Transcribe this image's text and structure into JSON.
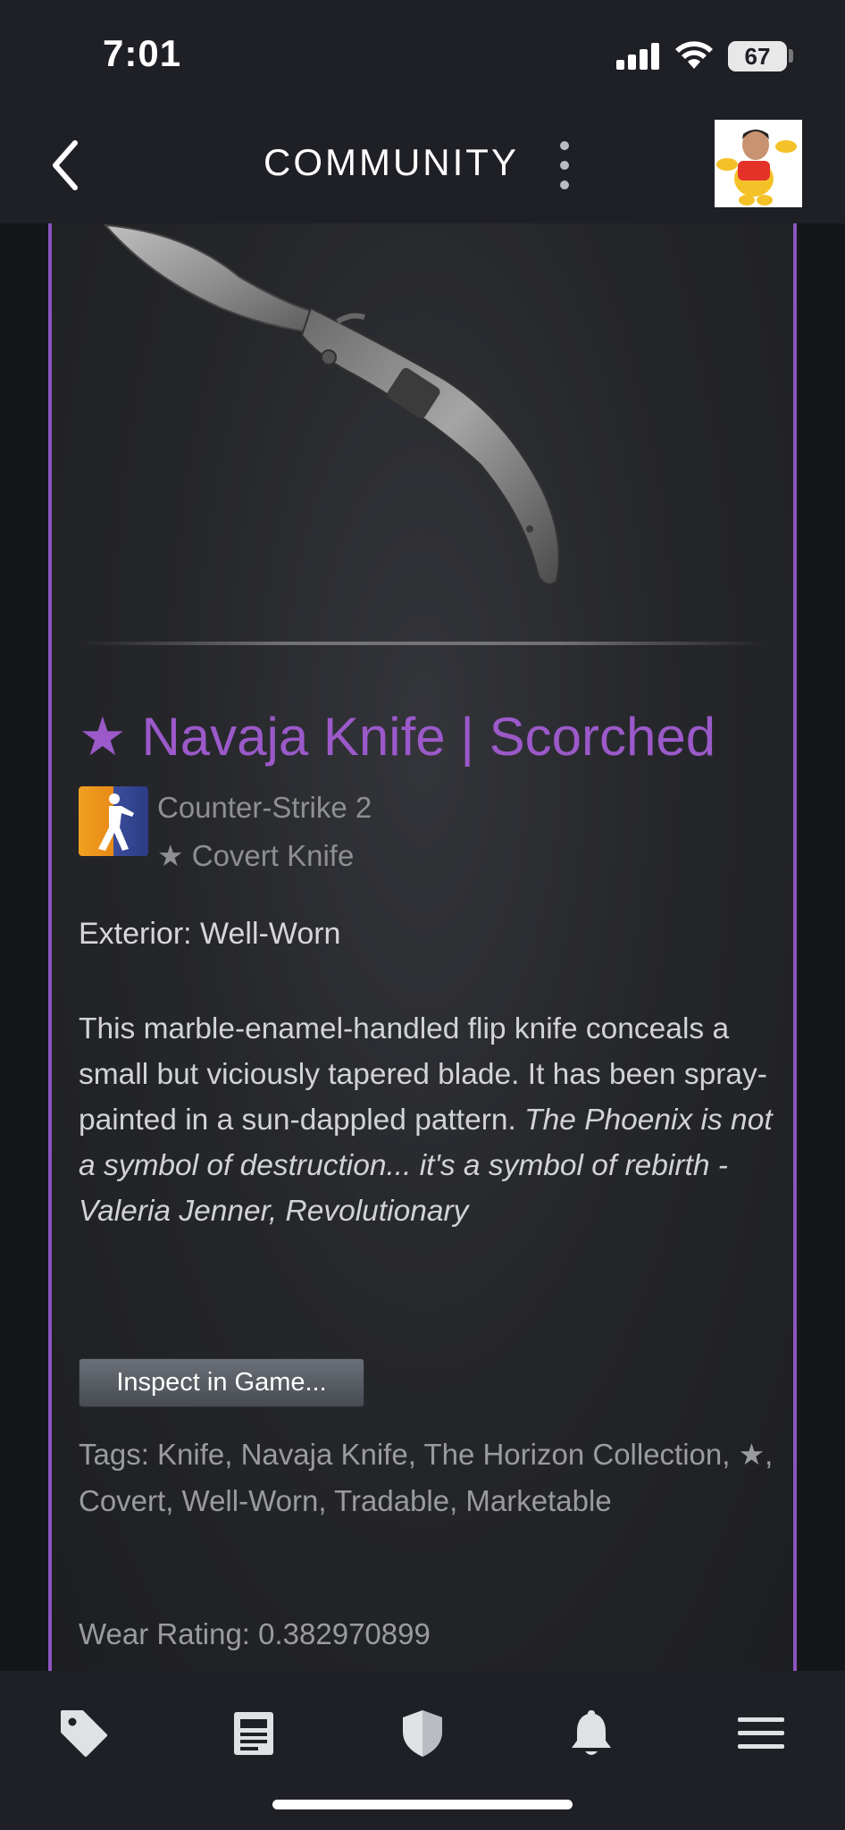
{
  "status_bar": {
    "time": "7:01",
    "battery": "67",
    "battery_fraction": 0.67
  },
  "nav": {
    "title": "COMMUNITY"
  },
  "item": {
    "name": "★ Navaja Knife | Scorched",
    "game": "Counter-Strike 2",
    "type": "★ Covert Knife",
    "exterior": "Exterior: Well-Worn",
    "description_plain": "This marble-enamel-handled flip knife conceals a small but viciously tapered blade. It has been spray-painted in a sun-dappled pattern. ",
    "description_quote": "The Phoenix is not a symbol of destruction... it's a symbol of rebirth - Valeria Jenner, Revolutionary",
    "inspect_label": "Inspect in Game...",
    "tags": "Tags: Knife, Navaja Knife, The Horizon Collection, ★, Covert, Well-Worn, Tradable, Marketable",
    "wear": "Wear Rating: 0.382970899",
    "name_color": "#9b59c9",
    "border_color": "#8b54c0"
  },
  "tab_bar": {
    "tabs": [
      {
        "icon": "tag-icon"
      },
      {
        "icon": "news-icon"
      },
      {
        "icon": "shield-icon"
      },
      {
        "icon": "bell-icon"
      },
      {
        "icon": "menu-icon"
      }
    ]
  }
}
